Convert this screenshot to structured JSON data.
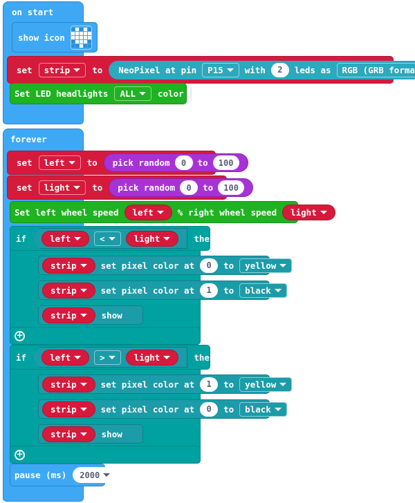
{
  "editor": {
    "name": "makecode-blocks-workspace",
    "background": "#ffffff"
  },
  "colors": {
    "event_blue": "#3EA8F5",
    "variable_red": "#D61A3C",
    "math_purple": "#A733D6",
    "custom_green": "#1FB222",
    "logic_teal": "#1B9CA8",
    "neopixel_cyan": "#2CA8BF",
    "loop_teal": "#00A1A1",
    "white": "#FFFFFF"
  },
  "scripts": {
    "on_start": {
      "hat_label": "on start",
      "blocks": {
        "show_icon": {
          "label": "show icon",
          "icon_name": "led-matrix-heart",
          "matrix": [
            [
              0,
              1,
              0,
              1,
              0
            ],
            [
              1,
              1,
              1,
              1,
              1
            ],
            [
              1,
              1,
              1,
              1,
              1
            ],
            [
              0,
              1,
              1,
              1,
              0
            ],
            [
              0,
              0,
              1,
              0,
              0
            ]
          ],
          "dropdown_icon": "chevron-down-icon"
        },
        "set_strip": {
          "set_label": "set",
          "variable": "strip",
          "to_label": "to",
          "neopixel": {
            "prefix": "NeoPixel at pin",
            "pin": "P15",
            "with_label": "with",
            "leds_count": "2",
            "leds_label": "leds as",
            "format": "RGB (GRB format)"
          }
        },
        "set_headlights": {
          "label": "Set LED headlights",
          "selector": "ALL",
          "color_label": "color",
          "color_value": "#FFFFFF"
        }
      }
    },
    "forever": {
      "hat_label": "forever",
      "blocks": {
        "set_left": {
          "set_label": "set",
          "variable": "left",
          "to_label": "to",
          "random": {
            "label": "pick random",
            "from": "0",
            "to_label": "to",
            "to": "100"
          }
        },
        "set_light": {
          "set_label": "set",
          "variable": "light",
          "to_label": "to",
          "random": {
            "label": "pick random",
            "from": "0",
            "to_label": "to",
            "to": "100"
          }
        },
        "wheel_speed": {
          "left_label": "Set left wheel speed",
          "left_value": "left",
          "pct1": "%",
          "right_label": "right wheel speed",
          "right_value": "light",
          "pct2": "%"
        },
        "if_less": {
          "if_label": "if",
          "operand_a": "left",
          "operator": "<",
          "operand_b": "light",
          "then_label": "then",
          "expander": "+",
          "body": [
            {
              "target": "strip",
              "label": "set pixel color at",
              "index": "0",
              "to_label": "to",
              "color": "yellow"
            },
            {
              "target": "strip",
              "label": "set pixel color at",
              "index": "1",
              "to_label": "to",
              "color": "black"
            },
            {
              "target": "strip",
              "label": "show"
            }
          ]
        },
        "if_greater": {
          "if_label": "if",
          "operand_a": "left",
          "operator": ">",
          "operand_b": "light",
          "then_label": "then",
          "expander": "+",
          "body": [
            {
              "target": "strip",
              "label": "set pixel color at",
              "index": "1",
              "to_label": "to",
              "color": "yellow"
            },
            {
              "target": "strip",
              "label": "set pixel color at",
              "index": "0",
              "to_label": "to",
              "color": "black"
            },
            {
              "target": "strip",
              "label": "show"
            }
          ]
        },
        "pause": {
          "label": "pause (ms)",
          "value": "2000"
        }
      }
    }
  }
}
